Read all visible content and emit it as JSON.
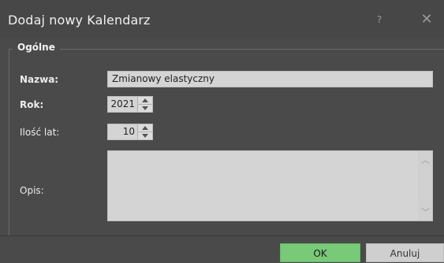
{
  "window": {
    "title": "Dodaj nowy Kalendarz",
    "help_glyph": "?",
    "close_glyph": "✕"
  },
  "group": {
    "title": "Ogólne"
  },
  "form": {
    "name_label": "Nazwa:",
    "name_value": "Zmianowy elastyczny",
    "year_label": "Rok:",
    "year_value": "2021",
    "years_count_label": "Ilość lat:",
    "years_count_value": "10",
    "description_label": "Opis:",
    "description_value": ""
  },
  "footer": {
    "ok_label": "OK",
    "cancel_label": "Anuluj"
  },
  "colors": {
    "background": "#4a4a4a",
    "ok_button": "#78c978",
    "field": "#d4d4d4"
  }
}
